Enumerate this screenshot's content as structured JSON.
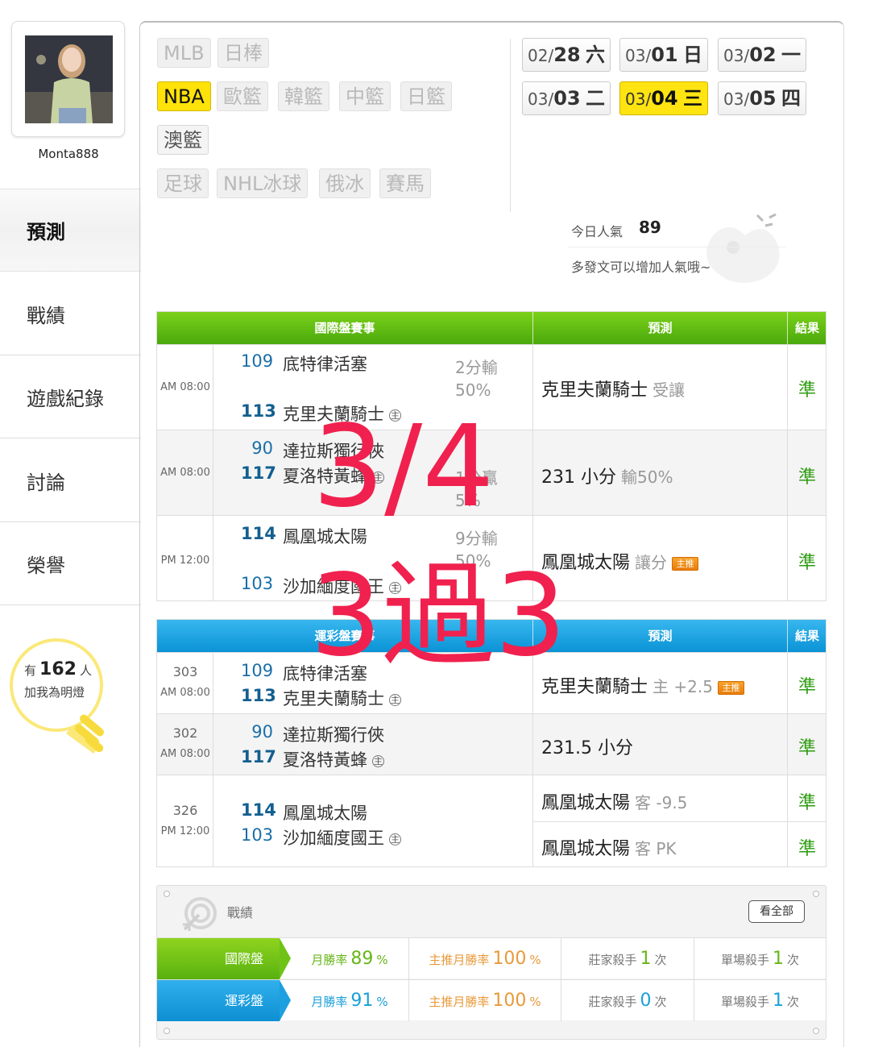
{
  "sidebar": {
    "username": "Monta888",
    "nav": [
      "預測",
      "戰績",
      "遊戲紀錄",
      "討論",
      "榮譽"
    ],
    "fans": {
      "prefix": "有",
      "count": "162",
      "suffix": "人",
      "note": "加我為明燈"
    }
  },
  "sports": {
    "row1": [
      "MLB",
      "日棒"
    ],
    "row2": [
      "NBA",
      "歐籃",
      "韓籃",
      "中籃",
      "日籃"
    ],
    "row3": [
      "澳籃"
    ],
    "row4": [
      "足球",
      "NHL冰球",
      "俄冰",
      "賽馬"
    ]
  },
  "dates": [
    {
      "month": "02/",
      "day": "28",
      "weekday": "六"
    },
    {
      "month": "03/",
      "day": "01",
      "weekday": "日"
    },
    {
      "month": "03/",
      "day": "02",
      "weekday": "一"
    },
    {
      "month": "03/",
      "day": "03",
      "weekday": "二"
    },
    {
      "month": "03/",
      "day": "04",
      "weekday": "三"
    },
    {
      "month": "03/",
      "day": "05",
      "weekday": "四"
    }
  ],
  "popularity": {
    "label": "今日人氣",
    "value": "89",
    "note": "多發文可以增加人氣哦~"
  },
  "intl_table": {
    "headers": [
      "國際盤賽事",
      "預測",
      "結果"
    ],
    "home_mark": "主",
    "rows": [
      {
        "time": "AM 08:00",
        "away_score": "109",
        "away_team": "底特律活塞",
        "home_score": "113",
        "home_team": "克里夫蘭騎士",
        "spread_line1": "2分輸",
        "spread_line2": "50%",
        "pred_main": "克里夫蘭騎士",
        "pred_sub": "受讓",
        "result": "準"
      },
      {
        "time": "AM 08:00",
        "away_score": "90",
        "away_team": "達拉斯獨行俠",
        "home_score": "117",
        "home_team": "夏洛特黃蜂",
        "spread_line1": "1分贏",
        "spread_line2": "5%",
        "pred_main": "231 小分",
        "pred_sub": "輸50%",
        "result": "準"
      },
      {
        "time": "PM 12:00",
        "away_score": "114",
        "away_team": "鳳凰城太陽",
        "home_score": "103",
        "home_team": "沙加緬度國王",
        "spread_line1": "9分輸",
        "spread_line2": "50%",
        "pred_main": "鳳凰城太陽",
        "pred_sub": "讓分",
        "badge": "主推",
        "result": "準"
      }
    ]
  },
  "lottery_table": {
    "headers": [
      "運彩盤賽事",
      "預測",
      "結果"
    ],
    "rows": [
      {
        "number": "303",
        "time": "AM 08:00",
        "away_score": "109",
        "away_team": "底特律活塞",
        "home_score": "113",
        "home_team": "克里夫蘭騎士",
        "pred_main": "克里夫蘭騎士",
        "pred_sub": "主 +2.5",
        "badge": "主推",
        "result": "準"
      },
      {
        "number": "302",
        "time": "AM 08:00",
        "away_score": "90",
        "away_team": "達拉斯獨行俠",
        "home_score": "117",
        "home_team": "夏洛特黃蜂",
        "pred_main": "231.5 小分",
        "result": "準"
      },
      {
        "number": "326",
        "time": "PM 12:00",
        "away_score": "114",
        "away_team": "鳳凰城太陽",
        "home_score": "103",
        "home_team": "沙加緬度國王",
        "pred1_main": "鳳凰城太陽",
        "pred1_sub": "客 -9.5",
        "result1": "準",
        "pred2_main": "鳳凰城太陽",
        "pred2_sub": "客 PK",
        "result2": "準"
      }
    ]
  },
  "stats": {
    "title": "戰績",
    "see_all": "看全部",
    "rows": [
      {
        "label": "國際盤",
        "monthly_label": "月勝率",
        "monthly": "89",
        "featured_label": "主推月勝率",
        "featured": "100",
        "pct": "%",
        "banker_label": "莊家殺手",
        "banker": "1",
        "single_label": "單場殺手",
        "single": "1",
        "times": "次"
      },
      {
        "label": "運彩盤",
        "monthly_label": "月勝率",
        "monthly": "91",
        "featured_label": "主推月勝率",
        "featured": "100",
        "pct": "%",
        "banker_label": "莊家殺手",
        "banker": "0",
        "single_label": "單場殺手",
        "single": "1",
        "times": "次"
      }
    ]
  },
  "overlay": {
    "line1": "3/4",
    "line2": "3過3"
  },
  "colors": {
    "accent_yellow": "#ffe20a",
    "intl_green": "#4aa90c",
    "lottery_blue": "#0b93d6",
    "result_green": "#2e9c12",
    "overlay_red": "#f0214e",
    "badge_orange": "#e97e09"
  }
}
